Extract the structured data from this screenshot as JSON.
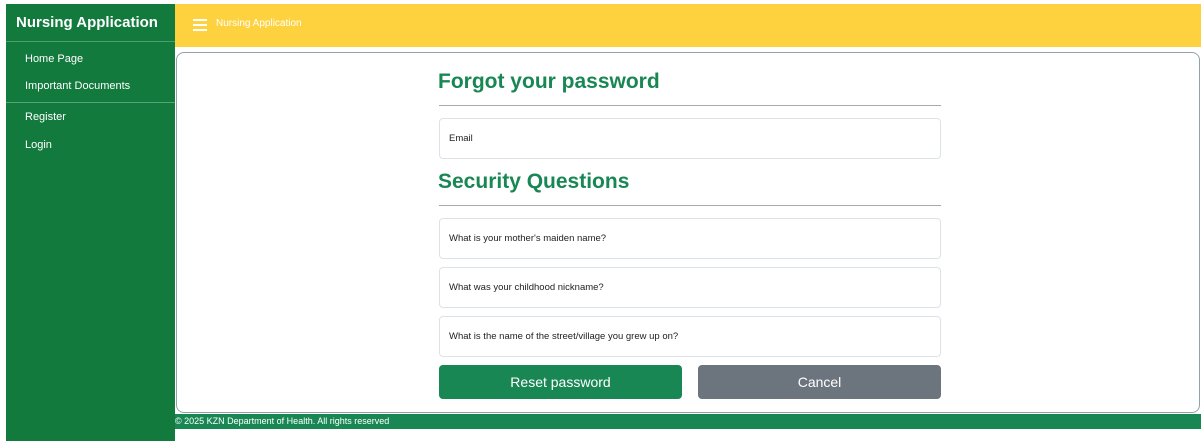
{
  "sidebar": {
    "brand": "Nursing Application",
    "items": [
      {
        "label": "Home Page"
      },
      {
        "label": "Important Documents"
      },
      {
        "label": "Register"
      },
      {
        "label": "Login"
      }
    ]
  },
  "topbar": {
    "title": "Nursing Application",
    "menu_icon": "hamburger-icon"
  },
  "form": {
    "heading": "Forgot your password",
    "email_placeholder": "Email",
    "security_heading": "Security Questions",
    "questions": [
      {
        "placeholder": "What is your mother's maiden name?"
      },
      {
        "placeholder": "What was your childhood nickname?"
      },
      {
        "placeholder": "What is the name of the street/village you grew up on?"
      }
    ],
    "reset_label": "Reset password",
    "cancel_label": "Cancel"
  },
  "footer": {
    "text": "© 2025 KZN Department of Health. All rights reserved"
  },
  "colors": {
    "sidebar": "#137a3e",
    "topbar": "#fdd23e",
    "accent": "#198754",
    "secondary": "#6c757d"
  }
}
